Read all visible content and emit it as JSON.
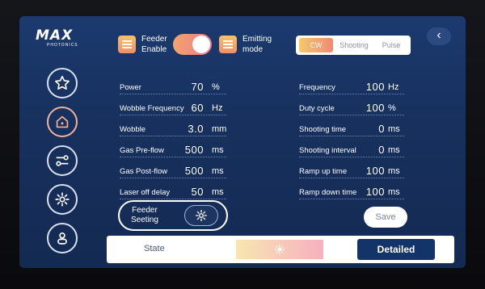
{
  "brand": {
    "name": "MAX",
    "subtitle": "PHOTONICS"
  },
  "sidebar": {
    "items": [
      {
        "icon": "star-icon"
      },
      {
        "icon": "home-icon",
        "active": true
      },
      {
        "icon": "sliders-icon"
      },
      {
        "icon": "gear-icon"
      },
      {
        "icon": "user-icon"
      }
    ]
  },
  "header": {
    "feeder_enable_label": "Feeder\nEnable",
    "feeder_enable_on": true,
    "emitting_mode_label": "Emitting\nmode",
    "modes": [
      "CW",
      "Shooting",
      "Pulse"
    ],
    "selected_mode": "CW",
    "back_label": "‹"
  },
  "params_left": [
    {
      "label": "Power",
      "value": "70",
      "unit": "%"
    },
    {
      "label": "Wobble Frequency",
      "value": "60",
      "unit": "Hz"
    },
    {
      "label": "Wobble",
      "value": "3.0",
      "unit": "mm"
    },
    {
      "label": "Gas Pre-flow",
      "value": "500",
      "unit": "ms"
    },
    {
      "label": "Gas Post-flow",
      "value": "500",
      "unit": "ms"
    },
    {
      "label": "Laser off delay",
      "value": "50",
      "unit": "ms"
    }
  ],
  "params_right": [
    {
      "label": "Frequency",
      "value": "100",
      "unit": "Hz"
    },
    {
      "label": "Duty cycle",
      "value": "100",
      "unit": "%"
    },
    {
      "label": "Shooting time",
      "value": "0",
      "unit": "ms"
    },
    {
      "label": "Shooting interval",
      "value": "0",
      "unit": "ms"
    },
    {
      "label": "Ramp up time",
      "value": "100",
      "unit": "ms"
    },
    {
      "label": "Ramp down time",
      "value": "100",
      "unit": "ms"
    }
  ],
  "feeder_seeting_label": "Feeder\nSeeting",
  "save_label": "Save",
  "state": {
    "label": "State",
    "detailed_label": "Detailed"
  },
  "colors": {
    "accent_start": "#f6c86a",
    "accent_end": "#ef8a74",
    "screen_bg": "#17305d",
    "detail_btn": "#123468"
  }
}
